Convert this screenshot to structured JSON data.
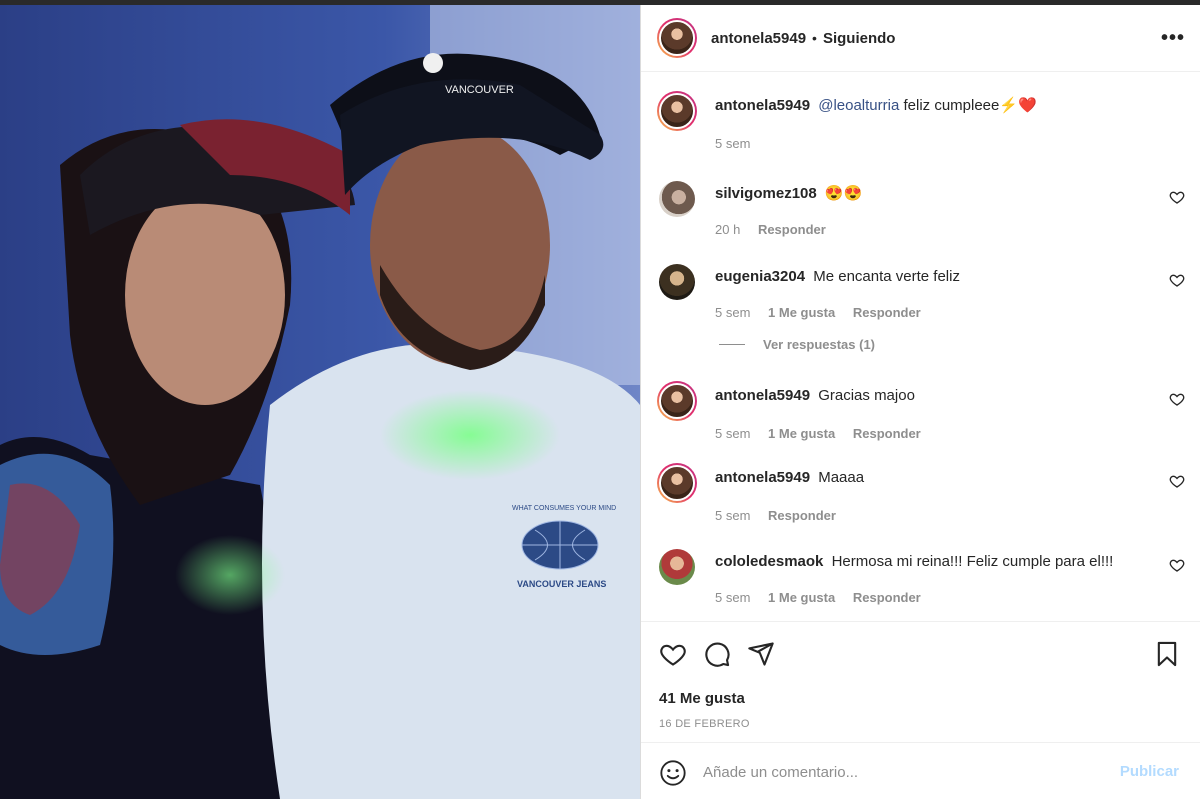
{
  "post": {
    "author": "antonela5949",
    "separator": "•",
    "follow_status": "Siguiendo",
    "more_label": "•••",
    "caption": {
      "user": "antonela5949",
      "mention": "@leoalturria",
      "text": "feliz cumpleee⚡❤️",
      "time": "5 sem"
    },
    "comments": [
      {
        "user": "silvigomez108",
        "text": "😍😍",
        "time": "20 h",
        "likes": "",
        "reply": "Responder"
      },
      {
        "user": "eugenia3204",
        "text": "Me encanta verte feliz",
        "time": "5 sem",
        "likes": "1 Me gusta",
        "reply": "Responder"
      },
      {
        "user": "antonela5949",
        "text": "Gracias majoo",
        "time": "5 sem",
        "likes": "1 Me gusta",
        "reply": "Responder"
      },
      {
        "user": "antonela5949",
        "text": "Maaaa",
        "time": "5 sem",
        "likes": "",
        "reply": "Responder"
      },
      {
        "user": "cololedesmaok",
        "text": "Hermosa mi reina!!! Feliz cumple para el!!!",
        "time": "5 sem",
        "likes": "1 Me gusta",
        "reply": "Responder"
      }
    ],
    "view_replies": "Ver respuestas (1)",
    "likes_count": "41 Me gusta",
    "date": "16 DE FEBRERO",
    "add_comment_placeholder": "Añade un comentario...",
    "publish_label": "Publicar",
    "photo_texts": {
      "shirt_top": "WHAT CONSUMES YOUR MIND",
      "shirt_bottom": "VANCOUVER JEANS",
      "cap_text": "VANCOUVER"
    }
  },
  "colors": {
    "link": "#385185",
    "muted": "#8e8e8e",
    "publish_disabled": "#b3dbff",
    "text": "#262626"
  },
  "icons": [
    "more-icon",
    "heart-icon",
    "comment-icon",
    "share-icon",
    "bookmark-icon",
    "emoji-icon"
  ]
}
